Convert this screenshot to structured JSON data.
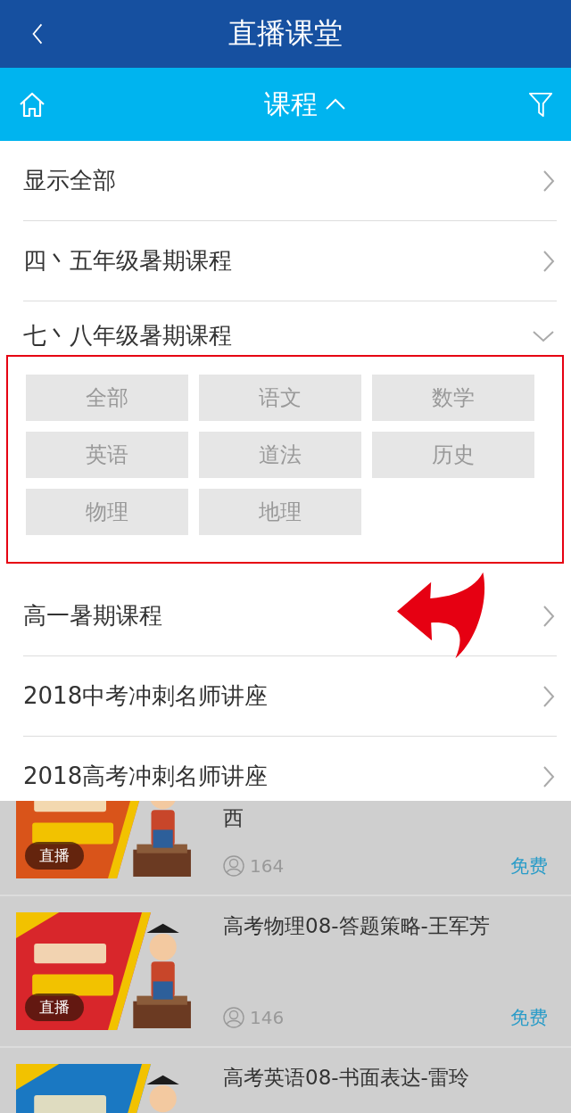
{
  "header": {
    "title": "直播课堂"
  },
  "toolbar": {
    "title": "课程",
    "expanded": true
  },
  "menu": [
    {
      "label": "显示全部",
      "expanded": false
    },
    {
      "label": "四丶五年级暑期课程",
      "expanded": false
    },
    {
      "label": "七丶八年级暑期课程",
      "expanded": true,
      "subjects": [
        "全部",
        "语文",
        "数学",
        "英语",
        "道法",
        "历史",
        "物理",
        "地理"
      ]
    },
    {
      "label": "高一暑期课程",
      "expanded": false
    },
    {
      "label": "2018中考冲刺名师讲座",
      "expanded": false
    },
    {
      "label": "2018高考冲刺名师讲座",
      "expanded": false
    }
  ],
  "courses": [
    {
      "title": "西",
      "badge": "直播",
      "viewers": "164",
      "price": "免费",
      "cut": true
    },
    {
      "title": "高考物理08-答题策略-王军芳",
      "badge": "直播",
      "viewers": "146",
      "price": "免费",
      "cut": false
    },
    {
      "title": "高考英语08-书面表达-雷玲",
      "cut": false
    }
  ]
}
